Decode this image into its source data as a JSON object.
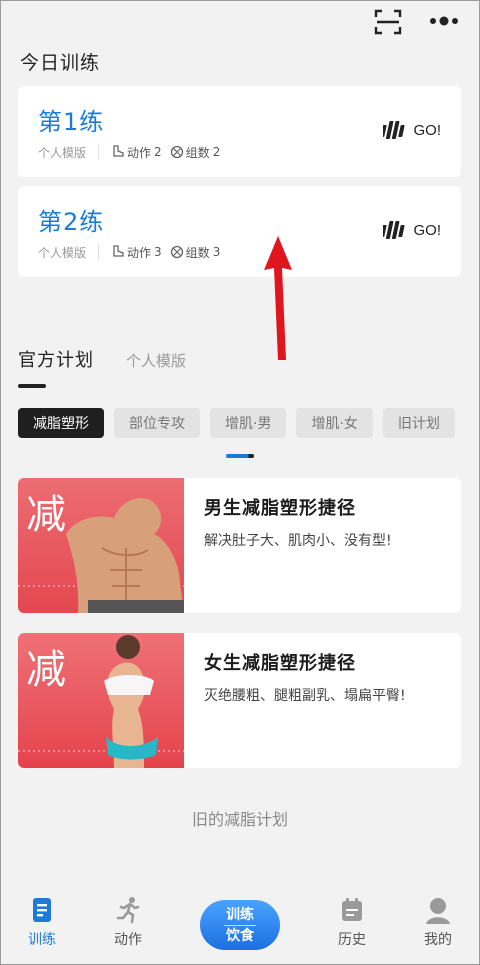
{
  "header": {
    "section_title": "今日训练"
  },
  "sessions": [
    {
      "title": "第1练",
      "source": "个人模版",
      "actions_label": "动作",
      "actions_count": "2",
      "sets_label": "组数",
      "sets_count": "2",
      "go_label": "GO!"
    },
    {
      "title": "第2练",
      "source": "个人模版",
      "actions_label": "动作",
      "actions_count": "3",
      "sets_label": "组数",
      "sets_count": "3",
      "go_label": "GO!"
    }
  ],
  "plan_tabs": {
    "active": "官方计划",
    "inactive": "个人模版"
  },
  "chips": [
    {
      "label": "减脂塑形",
      "active": true
    },
    {
      "label": "部位专攻",
      "active": false
    },
    {
      "label": "增肌·男",
      "active": false
    },
    {
      "label": "增肌·女",
      "active": false
    },
    {
      "label": "旧计划",
      "active": false
    }
  ],
  "plans": [
    {
      "thumb_char": "减",
      "title": "男生减脂塑形捷径",
      "desc": "解决肚子大、肌肉小、没有型!"
    },
    {
      "thumb_char": "减",
      "title": "女生减脂塑形捷径",
      "desc": "灭绝腰粗、腿粗副乳、塌扁平臀!"
    }
  ],
  "old_plans_link": "旧的减脂计划",
  "bottom_nav": {
    "train": "训练",
    "action": "动作",
    "center_top": "训练",
    "center_bottom": "饮食",
    "history": "历史",
    "mine": "我的"
  },
  "colors": {
    "accent": "#1a7bd9",
    "chip_active_bg": "#1f1f1f",
    "arrow": "#e0161e",
    "thumb_bg": "#e8545e"
  }
}
